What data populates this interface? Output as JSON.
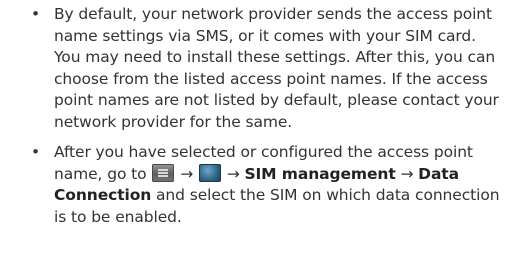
{
  "bullets": [
    {
      "dot": "•",
      "text": "By default, your network provider sends the access point name settings via SMS, or it comes with your SIM card. You may need to install these settings. After this, you can choose from the listed access point names. If the access point names are not listed by default, please contact your network provider for the same."
    },
    {
      "dot": "•",
      "seg1": "After you have selected or configured the access point name, go to",
      "icon1": "menu-icon",
      "arrow1": "→",
      "icon2": "settings-icon",
      "arrow2": "→",
      "bold1": "SIM management",
      "arrow3": "→",
      "bold2": "Data Connection",
      "seg2": "and select the SIM on which data connection is to be enabled."
    }
  ]
}
